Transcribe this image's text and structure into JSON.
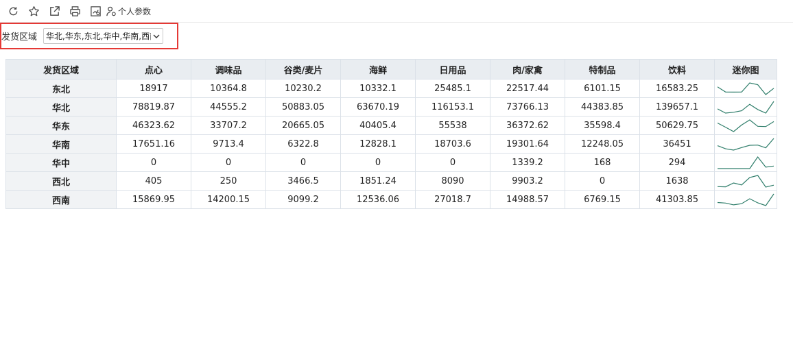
{
  "toolbar": {
    "icons": [
      "refresh-icon",
      "star-icon",
      "export-icon",
      "print-icon",
      "report-settings-icon",
      "user-params-icon"
    ],
    "personal_params_label": "个人参数"
  },
  "filter": {
    "label": "发货区域",
    "selected_value": "华北,华东,东北,华中,华南,西南,西北"
  },
  "table": {
    "columns": [
      "发货区域",
      "点心",
      "调味品",
      "谷类/麦片",
      "海鲜",
      "日用品",
      "肉/家禽",
      "特制品",
      "饮料",
      "迷你图"
    ],
    "rows": [
      {
        "region": "东北",
        "values": [
          "18917",
          "10364.8",
          "10230.2",
          "10332.1",
          "25485.1",
          "22517.44",
          "6101.15",
          "16583.25"
        ],
        "spark": [
          18917,
          10364.8,
          10230.2,
          10332.1,
          25485.1,
          22517.44,
          6101.15,
          16583.25
        ]
      },
      {
        "region": "华北",
        "values": [
          "78819.87",
          "44555.2",
          "50883.05",
          "63670.19",
          "116153.1",
          "73766.13",
          "44383.85",
          "139657.1"
        ],
        "spark": [
          78819.87,
          44555.2,
          50883.05,
          63670.19,
          116153.1,
          73766.13,
          44383.85,
          139657.1
        ]
      },
      {
        "region": "华东",
        "values": [
          "46323.62",
          "33707.2",
          "20665.05",
          "40405.4",
          "55538",
          "36372.62",
          "35598.4",
          "50629.75"
        ],
        "spark": [
          46323.62,
          33707.2,
          20665.05,
          40405.4,
          55538,
          36372.62,
          35598.4,
          50629.75
        ]
      },
      {
        "region": "华南",
        "values": [
          "17651.16",
          "9713.4",
          "6322.8",
          "12828.1",
          "18703.6",
          "19301.64",
          "12248.05",
          "36451"
        ],
        "spark": [
          17651.16,
          9713.4,
          6322.8,
          12828.1,
          18703.6,
          19301.64,
          12248.05,
          36451
        ]
      },
      {
        "region": "华中",
        "values": [
          "0",
          "0",
          "0",
          "0",
          "0",
          "1339.2",
          "168",
          "294"
        ],
        "spark": [
          0,
          0,
          0,
          0,
          0,
          1339.2,
          168,
          294
        ]
      },
      {
        "region": "西北",
        "values": [
          "405",
          "250",
          "3466.5",
          "1851.24",
          "8090",
          "9903.2",
          "0",
          "1638"
        ],
        "spark": [
          405,
          250,
          3466.5,
          1851.24,
          8090,
          9903.2,
          0,
          1638
        ]
      },
      {
        "region": "西南",
        "values": [
          "15869.95",
          "14200.15",
          "9099.2",
          "12536.06",
          "27018.7",
          "14988.57",
          "6769.15",
          "41303.85"
        ],
        "spark": [
          15869.95,
          14200.15,
          9099.2,
          12536.06,
          27018.7,
          14988.57,
          6769.15,
          41303.85
        ]
      }
    ]
  }
}
